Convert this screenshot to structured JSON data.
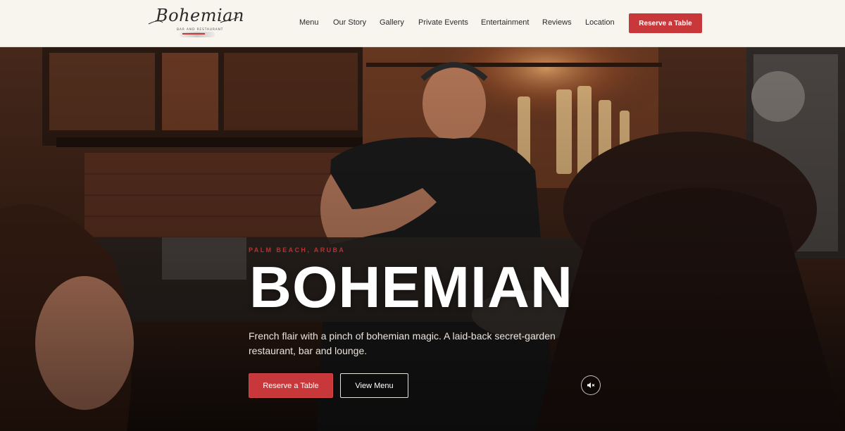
{
  "brand": {
    "logo_text": "Bohemian",
    "logo_subtext": "Bar and Restaurant"
  },
  "nav": {
    "items": [
      {
        "label": "Menu"
      },
      {
        "label": "Our Story"
      },
      {
        "label": "Gallery"
      },
      {
        "label": "Private Events"
      },
      {
        "label": "Entertainment"
      },
      {
        "label": "Reviews"
      },
      {
        "label": "Location"
      }
    ],
    "cta_label": "Reserve a Table"
  },
  "hero": {
    "eyebrow": "Palm Beach, Aruba",
    "title": "BOHEMIAN",
    "description": "French flair with a pinch of bohemian magic. A laid-back secret-garden restaurant, bar and lounge.",
    "primary_button": "Reserve a Table",
    "secondary_button": "View Menu",
    "mute_icon": "speaker-muted-icon"
  },
  "colors": {
    "accent": "#c8383a",
    "header_bg": "#f8f4ee",
    "text_dark": "#2b2b2b"
  }
}
